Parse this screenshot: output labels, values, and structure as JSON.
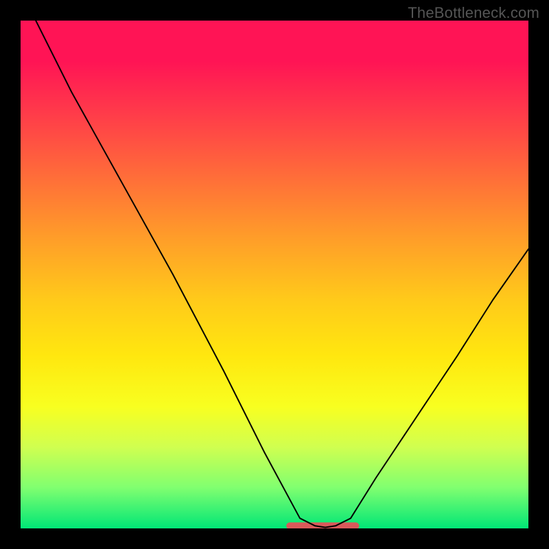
{
  "watermark": "TheBottleneck.com",
  "colors": {
    "frame_bg": "#000000",
    "gradient_top": "#ff1455",
    "gradient_mid": "#ffe70f",
    "gradient_bottom": "#00e676",
    "curve_stroke": "#000000",
    "floor_stroke": "#d95a5a"
  },
  "chart_data": {
    "type": "line",
    "title": "",
    "xlabel": "",
    "ylabel": "",
    "xlim": [
      0,
      100
    ],
    "ylim": [
      0,
      100
    ],
    "grid": false,
    "legend": false,
    "notes": "V-shaped bottleneck curve over a red→yellow→green vertical gradient. y≈100 at x≈3, descends roughly linearly to y≈0 near x≈55, stays near 0 (flat floor, highlighted red) until x≈65, then rises with slight convex curvature to y≈55 at x≈100. Values estimated from pixel positions; no axis ticks shown.",
    "series": [
      {
        "name": "curve",
        "x": [
          3,
          10,
          20,
          30,
          40,
          48,
          55,
          58,
          60,
          62,
          65,
          70,
          78,
          86,
          93,
          100
        ],
        "y": [
          100,
          86,
          68,
          50,
          31,
          15,
          2,
          0.5,
          0.2,
          0.5,
          2,
          10,
          22,
          34,
          45,
          55
        ]
      }
    ],
    "floor_segment": {
      "x_start": 53,
      "x_end": 66,
      "y": 0.5
    }
  }
}
